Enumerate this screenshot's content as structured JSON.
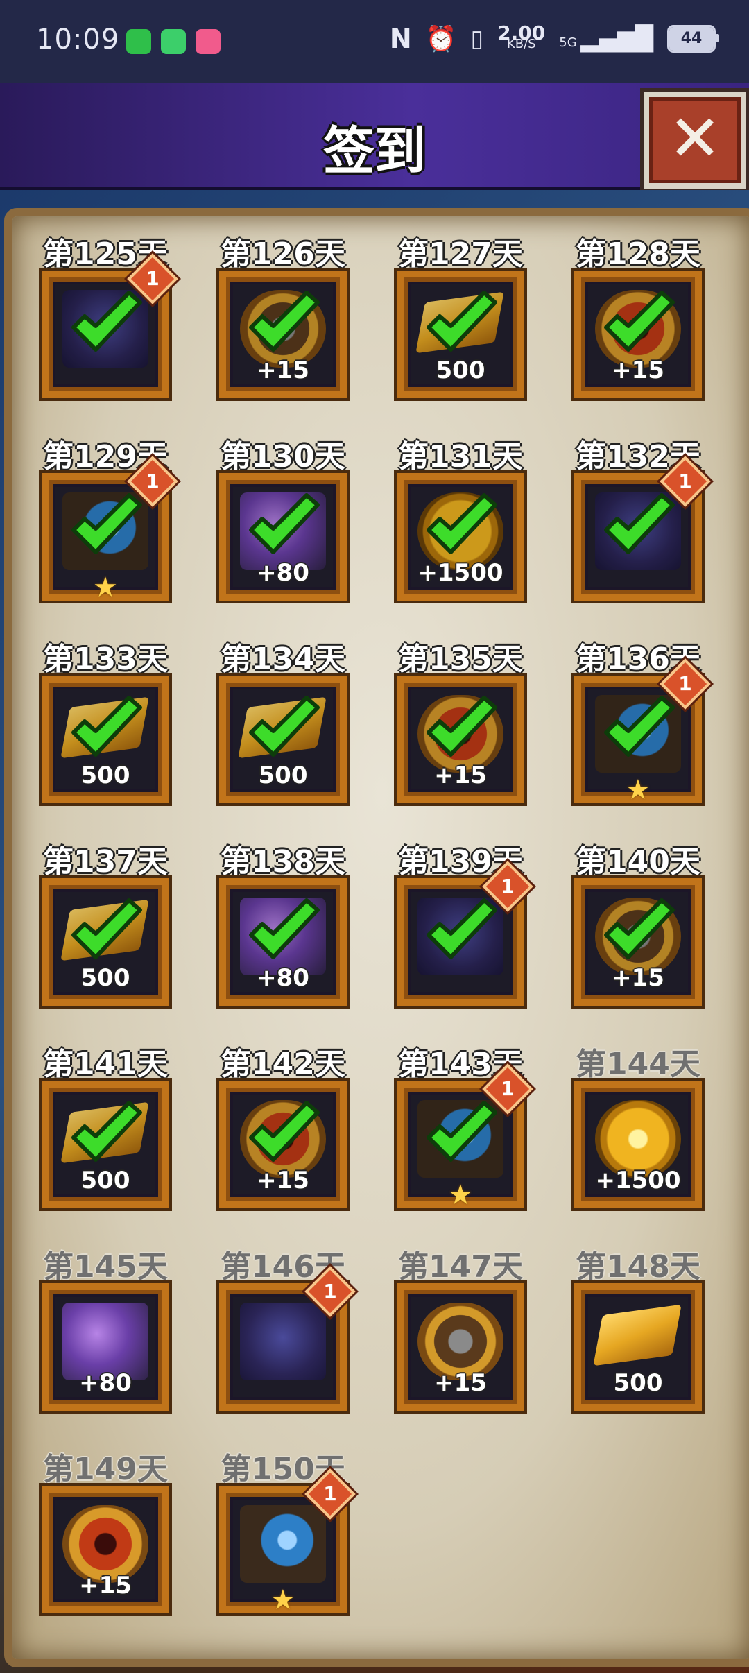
{
  "status_bar": {
    "time": "10:09",
    "net_speed_value": "2.00",
    "net_speed_unit": "KB/S",
    "signal_label": "5G",
    "battery": "44",
    "icons": [
      "shield-app-icon",
      "chat-app-icon",
      "video-app-icon",
      "nfc-icon",
      "alarm-icon",
      "vibrate-icon",
      "signal-icon",
      "battery-icon"
    ]
  },
  "header": {
    "title": "签到",
    "close_label": "✕"
  },
  "rows": [
    [
      {
        "day": "第125天",
        "item": "dragon",
        "qty": "",
        "claimed": true,
        "badge": "1",
        "star": false
      },
      {
        "day": "第126天",
        "item": "gold-anvil",
        "qty": "+15",
        "claimed": true,
        "badge": "",
        "star": false
      },
      {
        "day": "第127天",
        "item": "bar",
        "qty": "500",
        "claimed": true,
        "badge": "",
        "star": false
      },
      {
        "day": "第128天",
        "item": "fire",
        "qty": "+15",
        "claimed": true,
        "badge": "",
        "star": false
      }
    ],
    [
      {
        "day": "第129天",
        "item": "gauntlet",
        "qty": "",
        "claimed": true,
        "badge": "1",
        "star": true
      },
      {
        "day": "第130天",
        "item": "galaxy",
        "qty": "+80",
        "claimed": true,
        "badge": "",
        "star": false
      },
      {
        "day": "第131天",
        "item": "coin",
        "qty": "+1500",
        "claimed": true,
        "badge": "",
        "star": false
      },
      {
        "day": "第132天",
        "item": "dragon",
        "qty": "",
        "claimed": true,
        "badge": "1",
        "star": false
      }
    ],
    [
      {
        "day": "第133天",
        "item": "bar",
        "qty": "500",
        "claimed": true,
        "badge": "",
        "star": false
      },
      {
        "day": "第134天",
        "item": "bar",
        "qty": "500",
        "claimed": true,
        "badge": "",
        "star": false
      },
      {
        "day": "第135天",
        "item": "fire",
        "qty": "+15",
        "claimed": true,
        "badge": "",
        "star": false
      },
      {
        "day": "第136天",
        "item": "gauntlet",
        "qty": "",
        "claimed": true,
        "badge": "1",
        "star": true
      }
    ],
    [
      {
        "day": "第137天",
        "item": "bar",
        "qty": "500",
        "claimed": true,
        "badge": "",
        "star": false
      },
      {
        "day": "第138天",
        "item": "galaxy",
        "qty": "+80",
        "claimed": true,
        "badge": "",
        "star": false
      },
      {
        "day": "第139天",
        "item": "dragon",
        "qty": "",
        "claimed": true,
        "badge": "1",
        "star": false
      },
      {
        "day": "第140天",
        "item": "gold-anvil",
        "qty": "+15",
        "claimed": true,
        "badge": "",
        "star": false
      }
    ],
    [
      {
        "day": "第141天",
        "item": "bar",
        "qty": "500",
        "claimed": true,
        "badge": "",
        "star": false
      },
      {
        "day": "第142天",
        "item": "fire",
        "qty": "+15",
        "claimed": true,
        "badge": "",
        "star": false
      },
      {
        "day": "第143天",
        "item": "gauntlet",
        "qty": "",
        "claimed": true,
        "badge": "1",
        "star": true
      },
      {
        "day": "第144天",
        "item": "coin",
        "qty": "+1500",
        "claimed": false,
        "badge": "",
        "star": false
      }
    ],
    [
      {
        "day": "第145天",
        "item": "galaxy",
        "qty": "+80",
        "claimed": false,
        "badge": "",
        "star": false
      },
      {
        "day": "第146天",
        "item": "dragon",
        "qty": "",
        "claimed": false,
        "badge": "1",
        "star": false
      },
      {
        "day": "第147天",
        "item": "gold-anvil",
        "qty": "+15",
        "claimed": false,
        "badge": "",
        "star": false
      },
      {
        "day": "第148天",
        "item": "bar",
        "qty": "500",
        "claimed": false,
        "badge": "",
        "star": false
      }
    ],
    [
      {
        "day": "第149天",
        "item": "fire",
        "qty": "+15",
        "claimed": false,
        "badge": "",
        "star": false
      },
      {
        "day": "第150天",
        "item": "gauntlet",
        "qty": "",
        "claimed": false,
        "badge": "1",
        "star": true
      }
    ]
  ]
}
